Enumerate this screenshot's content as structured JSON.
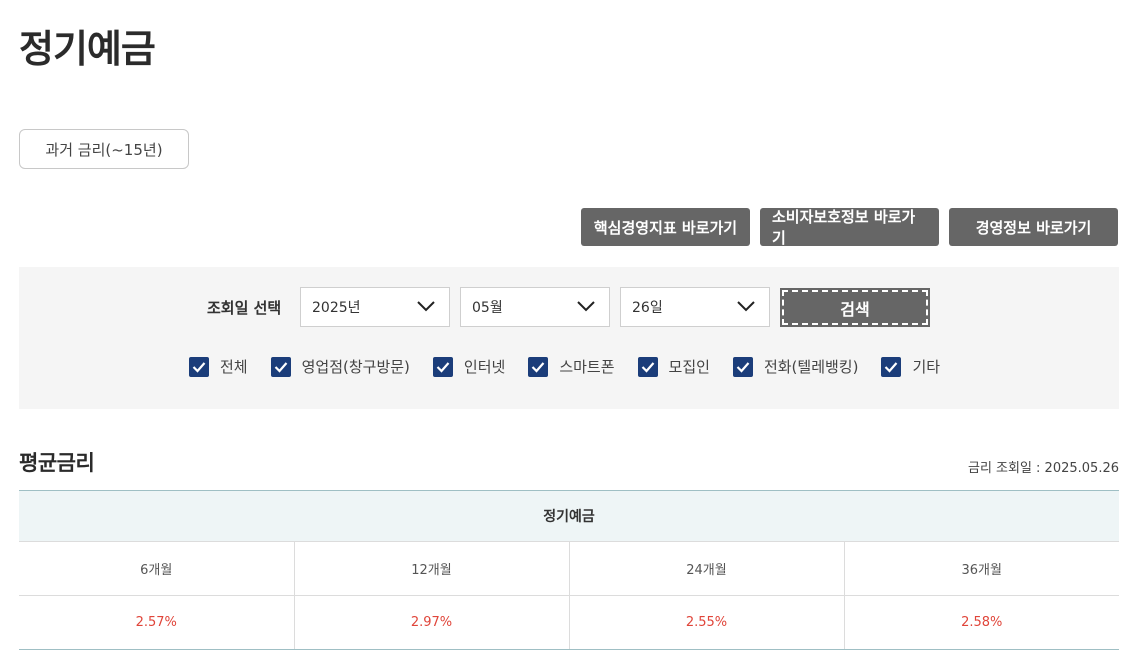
{
  "page": {
    "title": "정기예금"
  },
  "past_rate_button": {
    "label": "과거 금리(~15년)"
  },
  "shortcuts": [
    {
      "label": "핵심경영지표 바로가기"
    },
    {
      "label": "소비자보호정보 바로가기"
    },
    {
      "label": "경영정보 바로가기"
    }
  ],
  "search": {
    "date_label": "조회일 선택",
    "year": "2025년",
    "month": "05월",
    "day": "26일",
    "button_label": "검색",
    "channels": [
      {
        "label": "전체",
        "checked": true
      },
      {
        "label": "영업점(창구방문)",
        "checked": true
      },
      {
        "label": "인터넷",
        "checked": true
      },
      {
        "label": "스마트폰",
        "checked": true
      },
      {
        "label": "모집인",
        "checked": true
      },
      {
        "label": "전화(텔레뱅킹)",
        "checked": true
      },
      {
        "label": "기타",
        "checked": true
      }
    ]
  },
  "average_rate": {
    "title": "평균금리",
    "lookup_date": "금리 조회일 : 2025.05.26",
    "table": {
      "group_header": "정기예금",
      "periods": [
        "6개월",
        "12개월",
        "24개월",
        "36개월"
      ],
      "rates": [
        "2.57%",
        "2.97%",
        "2.55%",
        "2.58%"
      ]
    }
  },
  "colors": {
    "accent_dark": "#666666",
    "checkbox": "#1b3d7a",
    "rate_value": "#e0453a",
    "table_header_bg": "#eef5f6"
  }
}
